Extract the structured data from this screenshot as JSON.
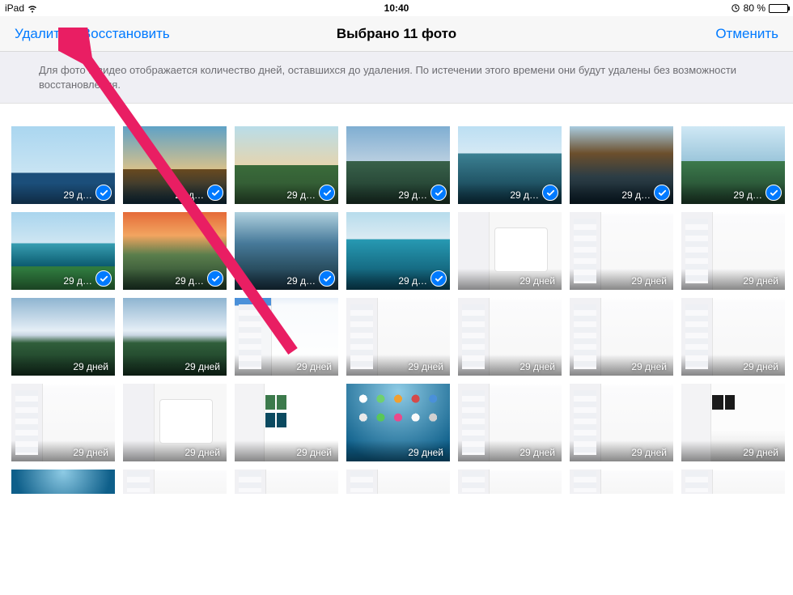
{
  "statusbar": {
    "device": "iPad",
    "time": "10:40",
    "battery_pct": "80 %",
    "wifi": true,
    "rotation_lock": true
  },
  "navbar": {
    "delete_label": "Удалить",
    "recover_label": "Восстановить",
    "title": "Выбрано 11 фото",
    "cancel_label": "Отменить"
  },
  "banner": {
    "text": "Для фото и видео отображается количество дней, оставшихся до удаления. По истечении этого времени они будут удалены без возможности восстановления."
  },
  "days_labels": {
    "short": "29 д…",
    "full": "29 дней"
  },
  "photos": [
    {
      "bg": "sky-1",
      "selected": true,
      "label_type": "short"
    },
    {
      "bg": "sky-2",
      "selected": true,
      "label_type": "short"
    },
    {
      "bg": "sky-3",
      "selected": true,
      "label_type": "short"
    },
    {
      "bg": "sky-4",
      "selected": true,
      "label_type": "short"
    },
    {
      "bg": "sky-5",
      "selected": true,
      "label_type": "short"
    },
    {
      "bg": "sky-6",
      "selected": true,
      "label_type": "short"
    },
    {
      "bg": "sky-7",
      "selected": true,
      "label_type": "short"
    },
    {
      "bg": "sky-9",
      "selected": true,
      "label_type": "short"
    },
    {
      "bg": "sky-10",
      "selected": true,
      "label_type": "short"
    },
    {
      "bg": "sky-11",
      "selected": true,
      "label_type": "short"
    },
    {
      "bg": "sky-12",
      "selected": true,
      "label_type": "short"
    },
    {
      "bg": "shot-popup shot-light",
      "selected": false,
      "label_type": "full"
    },
    {
      "bg": "shot-light",
      "selected": false,
      "label_type": "full"
    },
    {
      "bg": "shot-light",
      "selected": false,
      "label_type": "full"
    },
    {
      "bg": "sky-mtn",
      "selected": false,
      "label_type": "full"
    },
    {
      "bg": "sky-mtn",
      "selected": false,
      "label_type": "full"
    },
    {
      "bg": "shot-mail shot-light",
      "selected": false,
      "label_type": "full"
    },
    {
      "bg": "shot-light",
      "selected": false,
      "label_type": "full"
    },
    {
      "bg": "shot-light",
      "selected": false,
      "label_type": "full"
    },
    {
      "bg": "shot-light",
      "selected": false,
      "label_type": "full"
    },
    {
      "bg": "shot-light",
      "selected": false,
      "label_type": "full"
    },
    {
      "bg": "shot-light",
      "selected": false,
      "label_type": "full"
    },
    {
      "bg": "shot-light shot-popup",
      "selected": false,
      "label_type": "full"
    },
    {
      "bg": "shot-gallery shot-light",
      "selected": false,
      "label_type": "full"
    },
    {
      "bg": "shot-home",
      "selected": false,
      "label_type": "full"
    },
    {
      "bg": "shot-light",
      "selected": false,
      "label_type": "full"
    },
    {
      "bg": "shot-light",
      "selected": false,
      "label_type": "full"
    },
    {
      "bg": "shot-dark shot-light",
      "selected": false,
      "label_type": "full"
    }
  ],
  "bottom_row": [
    {
      "bg": "shot-home"
    },
    {
      "bg": "shot-light"
    },
    {
      "bg": "shot-light"
    },
    {
      "bg": "shot-light"
    },
    {
      "bg": "shot-light"
    },
    {
      "bg": "shot-light"
    },
    {
      "bg": "shot-light"
    }
  ]
}
